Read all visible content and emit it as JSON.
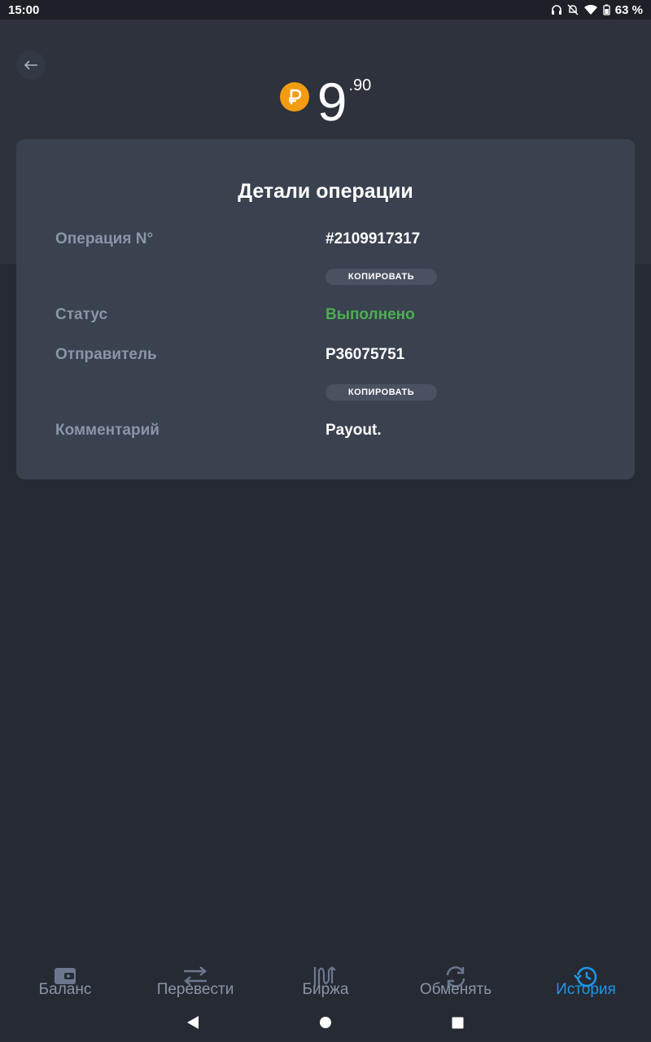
{
  "status_bar": {
    "time": "15:00",
    "battery": "63 %"
  },
  "header": {
    "amount_integer": "9",
    "amount_fraction": ".90",
    "currency_icon": "ruble-coin-icon"
  },
  "details": {
    "title": "Детали операции",
    "rows": [
      {
        "label": "Операция N°",
        "value": "#2109917317",
        "copy_label": "КОПИРОВАТЬ"
      },
      {
        "label": "Статус",
        "value": "Выполнено"
      },
      {
        "label": "Отправитель",
        "value": "P36075751",
        "copy_label": "КОПИРОВАТЬ"
      },
      {
        "label": "Комментарий",
        "value": "Payout."
      }
    ]
  },
  "bottom_nav": {
    "items": [
      {
        "label": "Баланс",
        "icon": "wallet-icon",
        "active": false
      },
      {
        "label": "Перевести",
        "icon": "transfer-icon",
        "active": false
      },
      {
        "label": "Биржа",
        "icon": "exchange-chart-icon",
        "active": false
      },
      {
        "label": "Обменять",
        "icon": "swap-icon",
        "active": false
      },
      {
        "label": "История",
        "icon": "history-icon",
        "active": true
      }
    ]
  },
  "colors": {
    "background": "#262a33",
    "header": "#2d323c",
    "card": "#3a414f",
    "label": "#8a95a8",
    "success": "#4caf50",
    "accent": "#1e96e6",
    "coin": "#f39c12"
  }
}
